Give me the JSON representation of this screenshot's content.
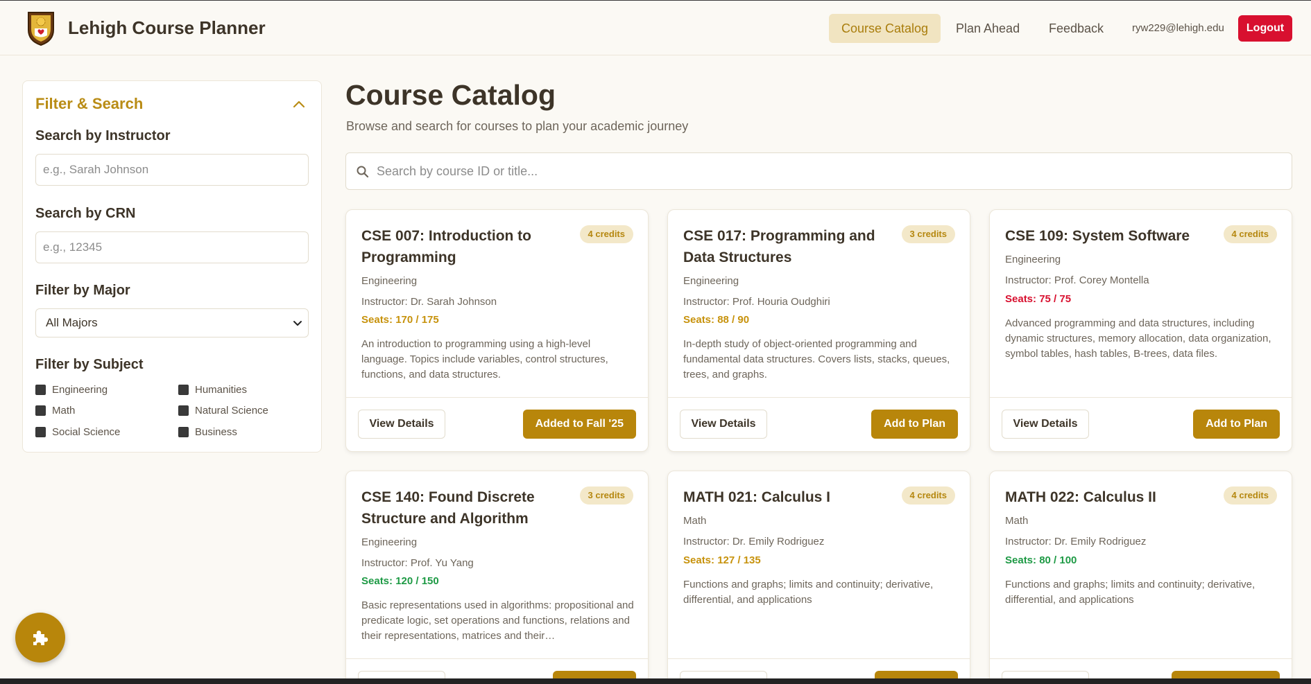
{
  "header": {
    "brand": "Lehigh Course Planner",
    "nav": [
      "Course Catalog",
      "Plan Ahead",
      "Feedback"
    ],
    "active_nav": "Course Catalog",
    "user_email": "ryw229@lehigh.edu",
    "logout_label": "Logout"
  },
  "sidebar": {
    "title": "Filter & Search",
    "instructor_label": "Search by Instructor",
    "instructor_placeholder": "e.g., Sarah Johnson",
    "crn_label": "Search by CRN",
    "crn_placeholder": "e.g., 12345",
    "major_label": "Filter by Major",
    "major_value": "All Majors",
    "subject_label": "Filter by Subject",
    "subjects": [
      "Engineering",
      "Humanities",
      "Math",
      "Natural Science",
      "Social Science",
      "Business"
    ]
  },
  "main": {
    "title": "Course Catalog",
    "subtitle": "Browse and search for courses to plan your academic journey",
    "search_placeholder": "Search by course ID or title..."
  },
  "courses": [
    {
      "title": "CSE 007: Introduction to Programming",
      "credits": "4 credits",
      "subject": "Engineering",
      "instructor": "Instructor: Dr. Sarah Johnson",
      "seats": "Seats: 170 / 175",
      "seats_color": "#c7920c",
      "description": "An introduction to programming using a high-level language. Topics include variables, control structures, functions, and data structures.",
      "details_label": "View Details",
      "action_label": "Added to Fall '25"
    },
    {
      "title": "CSE 017: Programming and Data Structures",
      "credits": "3 credits",
      "subject": "Engineering",
      "instructor": "Instructor: Prof. Houria Oudghiri",
      "seats": "Seats: 88 / 90",
      "seats_color": "#c7920c",
      "description": "In-depth study of object-oriented programming and fundamental data structures. Covers lists, stacks, queues, trees, and graphs.",
      "details_label": "View Details",
      "action_label": "Add to Plan"
    },
    {
      "title": "CSE 109: System Software",
      "credits": "4 credits",
      "subject": "Engineering",
      "instructor": "Instructor: Prof. Corey Montella",
      "seats": "Seats: 75 / 75",
      "seats_color": "#d8102f",
      "description": "Advanced programming and data structures, including dynamic structures, memory allocation, data organization, symbol tables, hash tables, B-trees, data files.",
      "details_label": "View Details",
      "action_label": "Add to Plan"
    },
    {
      "title": "CSE 140: Found Discrete Structure and Algorithm",
      "credits": "3 credits",
      "subject": "Engineering",
      "instructor": "Instructor: Prof. Yu Yang",
      "seats": "Seats: 120 / 150",
      "seats_color": "#1e9a45",
      "description": "Basic representations used in algorithms: propositional and predicate logic, set operations and functions, relations and their representations, matrices and their…"
    },
    {
      "title": "MATH 021: Calculus I",
      "credits": "4 credits",
      "subject": "Math",
      "instructor": "Instructor: Dr. Emily Rodriguez",
      "seats": "Seats: 127 / 135",
      "seats_color": "#c7920c",
      "description": "Functions and graphs; limits and continuity; derivative, differential, and applications"
    },
    {
      "title": "MATH 022: Calculus II",
      "credits": "4 credits",
      "subject": "Math",
      "instructor": "Instructor: Dr. Emily Rodriguez",
      "seats": "Seats: 80 / 100",
      "seats_color": "#1e9a45",
      "description": "Functions and graphs; limits and continuity; derivative, differential, and applications"
    }
  ]
}
